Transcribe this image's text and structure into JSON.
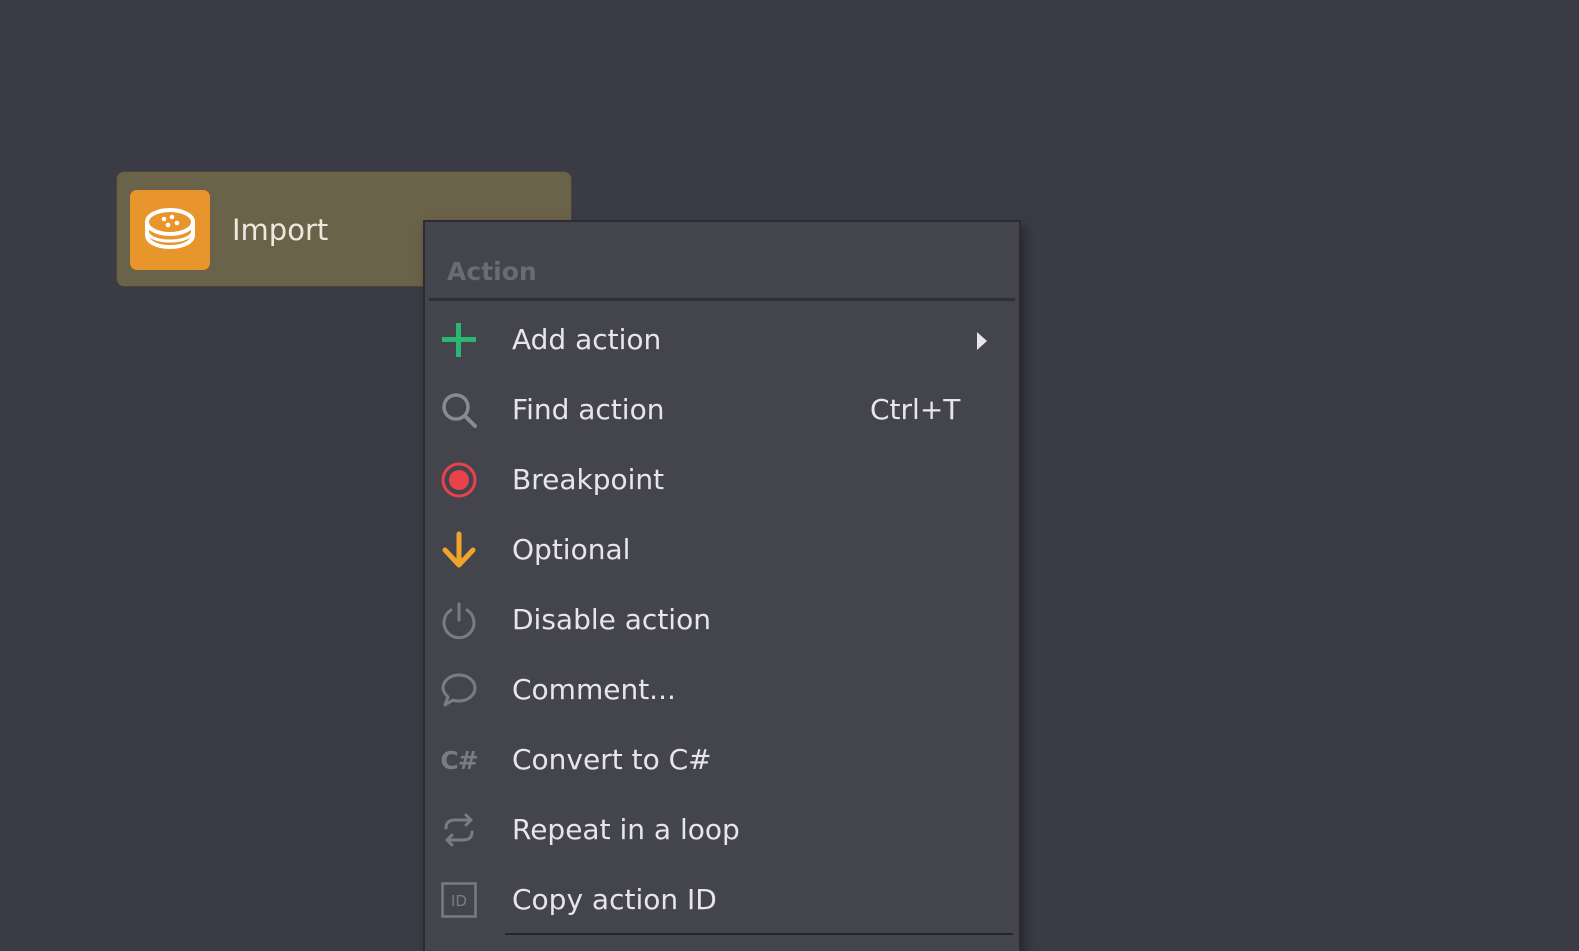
{
  "node": {
    "label": "Import",
    "icon": "database-import-icon",
    "color": "#e8962b"
  },
  "menu": {
    "header": "Action",
    "items": [
      {
        "label": "Add action",
        "icon": "plus-icon",
        "icon_color": "#2bb673",
        "has_submenu": true,
        "shortcut": ""
      },
      {
        "label": "Find action",
        "icon": "search-icon",
        "icon_color": "#8a8a92",
        "has_submenu": false,
        "shortcut": "Ctrl+T"
      },
      {
        "label": "Breakpoint",
        "icon": "breakpoint-icon",
        "icon_color": "#e8434a",
        "has_submenu": false,
        "shortcut": ""
      },
      {
        "label": "Optional",
        "icon": "arrow-down-icon",
        "icon_color": "#f0a52a",
        "has_submenu": false,
        "shortcut": ""
      },
      {
        "label": "Disable action",
        "icon": "power-icon",
        "icon_color": "#7b7b84",
        "has_submenu": false,
        "shortcut": ""
      },
      {
        "label": "Comment...",
        "icon": "comment-icon",
        "icon_color": "#7b7b84",
        "has_submenu": false,
        "shortcut": ""
      },
      {
        "label": "Convert to C#",
        "icon": "csharp-icon",
        "icon_text": "C#",
        "icon_color": "#7b7b84",
        "has_submenu": false,
        "shortcut": ""
      },
      {
        "label": "Repeat in a loop",
        "icon": "loop-icon",
        "icon_color": "#7b7b84",
        "has_submenu": false,
        "shortcut": ""
      },
      {
        "label": "Copy action ID",
        "icon": "id-icon",
        "icon_text": "ID",
        "icon_color": "#7b7b84",
        "has_submenu": false,
        "shortcut": ""
      }
    ]
  }
}
